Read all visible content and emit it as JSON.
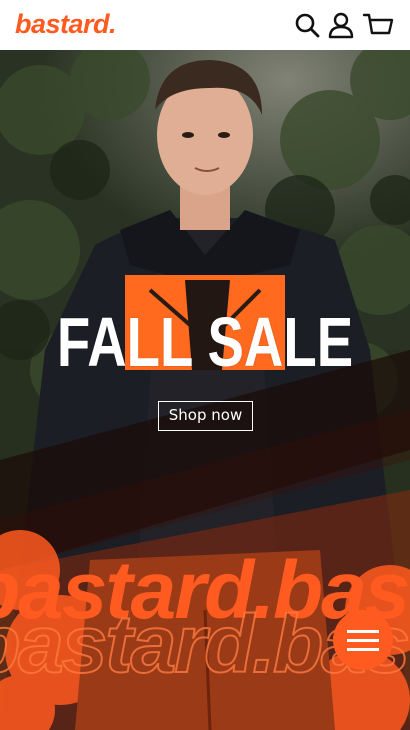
{
  "header": {
    "logo": "bastard.",
    "icons": [
      "search-icon",
      "account-icon",
      "cart-icon"
    ]
  },
  "hero": {
    "headline": "FALL SALE",
    "cta_label": "Shop now",
    "background_word": "bastard.bastard."
  },
  "menu": {
    "icon": "hamburger-icon"
  },
  "colors": {
    "brand": "#ff5a1f",
    "header_bg": "#ffffff",
    "overlay_dark": "#1a0b08"
  }
}
